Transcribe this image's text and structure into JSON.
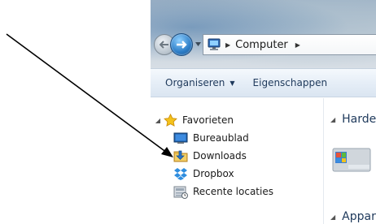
{
  "address_bar": {
    "location": "Computer",
    "computer_icon": "computer-icon"
  },
  "command_bar": {
    "organize_label": "Organiseren",
    "properties_label": "Eigenschappen"
  },
  "nav_pane": {
    "favorites": {
      "label": "Favorieten",
      "icon": "star-icon",
      "items": [
        {
          "label": "Bureaublad",
          "icon": "desktop-icon"
        },
        {
          "label": "Downloads",
          "icon": "downloads-folder-icon"
        },
        {
          "label": "Dropbox",
          "icon": "dropbox-icon"
        },
        {
          "label": "Recente locaties",
          "icon": "recent-places-icon"
        }
      ]
    }
  },
  "content_pane": {
    "groups": [
      {
        "label": "Harde schijven"
      },
      {
        "label": "Apparaten met verwisselbare opslag"
      }
    ]
  },
  "annotation": {
    "arrow_color": "#000000",
    "target": "downloads"
  }
}
